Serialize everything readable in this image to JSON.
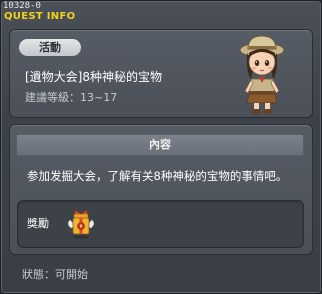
{
  "window": {
    "quest_id": "10328-0",
    "title": "QUEST INFO"
  },
  "quest": {
    "category_tag": "活動",
    "name": "[遺物大会]8种神秘的宝物",
    "recommended_level": "建議等級：13~17"
  },
  "content": {
    "header": "內容",
    "description": "参加发掘大会，了解有关8种神秘的宝物的事情吧。"
  },
  "reward": {
    "label": "獎勵",
    "item_icon": "gift-box-icon"
  },
  "status": {
    "text": "狀態：可開始"
  },
  "colors": {
    "title": "#f3d21a",
    "background": "#3d4249"
  }
}
